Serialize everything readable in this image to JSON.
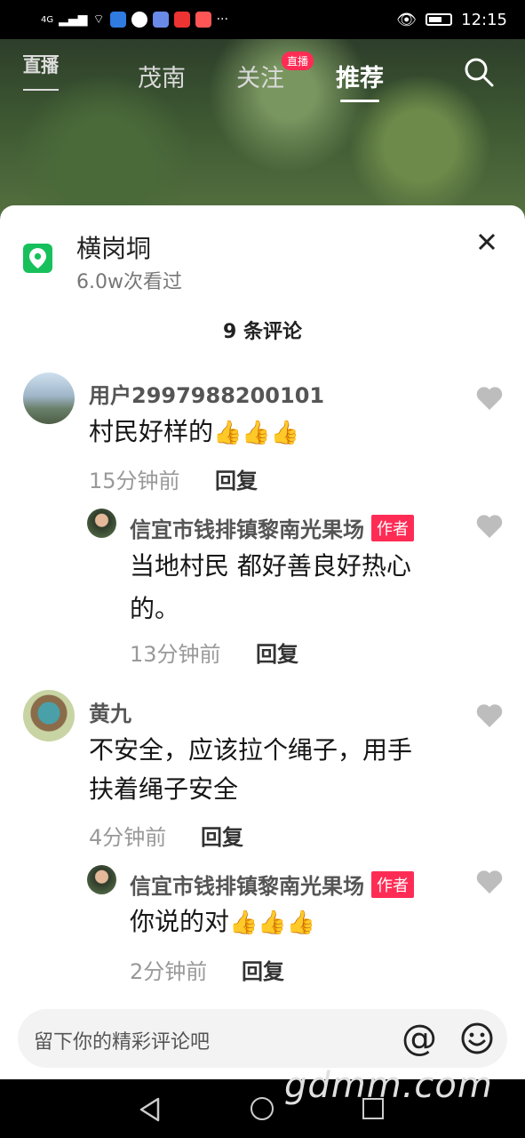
{
  "status_bar": {
    "network": "4G",
    "time": "12:15",
    "more": "···"
  },
  "top_nav": {
    "live_label": "直播",
    "tabs": [
      "茂南",
      "关注",
      "推荐"
    ],
    "live_badge": "直播",
    "active_tab": "推荐"
  },
  "sheet": {
    "location": {
      "name": "横岗垌",
      "views": "6.0w次看过"
    },
    "comment_count": "9 条评论",
    "comments": [
      {
        "user": "用户2997988200101",
        "text": "村民好样的",
        "emoji": "👍👍👍",
        "time": "15分钟前",
        "reply": "回复",
        "replies": [
          {
            "user": "信宜市钱排镇黎南光果场",
            "tag": "作者",
            "text_line1": "当地村民 都好善良好热心",
            "text_line2": "的。",
            "time": "13分钟前",
            "reply": "回复"
          }
        ]
      },
      {
        "user": "黄九",
        "text_line1": "不安全，应该拉个绳子，用手",
        "text_line2": "扶着绳子安全",
        "time": "4分钟前",
        "reply": "回复",
        "replies": [
          {
            "user": "信宜市钱排镇黎南光果场",
            "tag": "作者",
            "text": "你说的对",
            "emoji": "👍👍👍",
            "time": "2分钟前",
            "reply": "回复"
          }
        ]
      }
    ]
  },
  "input": {
    "placeholder": "留下你的精彩评论吧",
    "at_symbol": "@"
  },
  "watermark": "gdmm.com",
  "colors": {
    "accent": "#fe2c55",
    "location_green": "#18c05c"
  }
}
